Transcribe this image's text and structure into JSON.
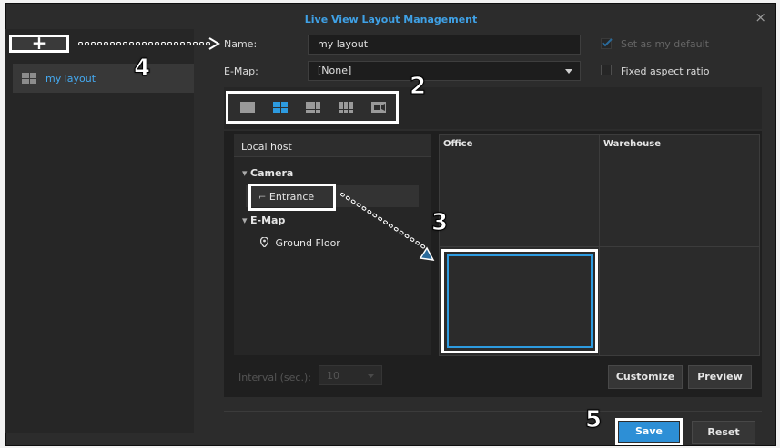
{
  "window": {
    "title": "Live View Layout Management",
    "close_label": "×"
  },
  "left_panel": {
    "add_label": "+",
    "layouts": [
      {
        "label": "my layout"
      }
    ]
  },
  "form": {
    "name_label": "Name:",
    "name_value": "my layout",
    "emap_label": "E-Map:",
    "emap_value": "[None]",
    "set_default_label": "Set as my default",
    "fixed_aspect_label": "Fixed aspect ratio"
  },
  "layout_icons": [
    "single-view-icon",
    "grid-2x2-icon",
    "grid-3x3-icon",
    "grid-4x4-icon",
    "camera-view-icon"
  ],
  "tree": {
    "header": "Local host",
    "camera_label": "Camera",
    "camera_items": [
      "Entrance"
    ],
    "emap_label": "E-Map",
    "emap_items": [
      "Ground Floor"
    ]
  },
  "grid_cells": {
    "top_left": "Office",
    "top_right": "Warehouse"
  },
  "interval": {
    "label": "Interval (sec.):",
    "value": "10"
  },
  "buttons": {
    "customize": "Customize",
    "preview": "Preview",
    "save": "Save",
    "reset": "Reset"
  },
  "annotations": {
    "step2": "2",
    "step3": "3",
    "step4": "4",
    "step5": "5"
  },
  "colors": {
    "accent": "#2d9be0",
    "title": "#3fa1e6",
    "background": "#2c2c2c"
  }
}
